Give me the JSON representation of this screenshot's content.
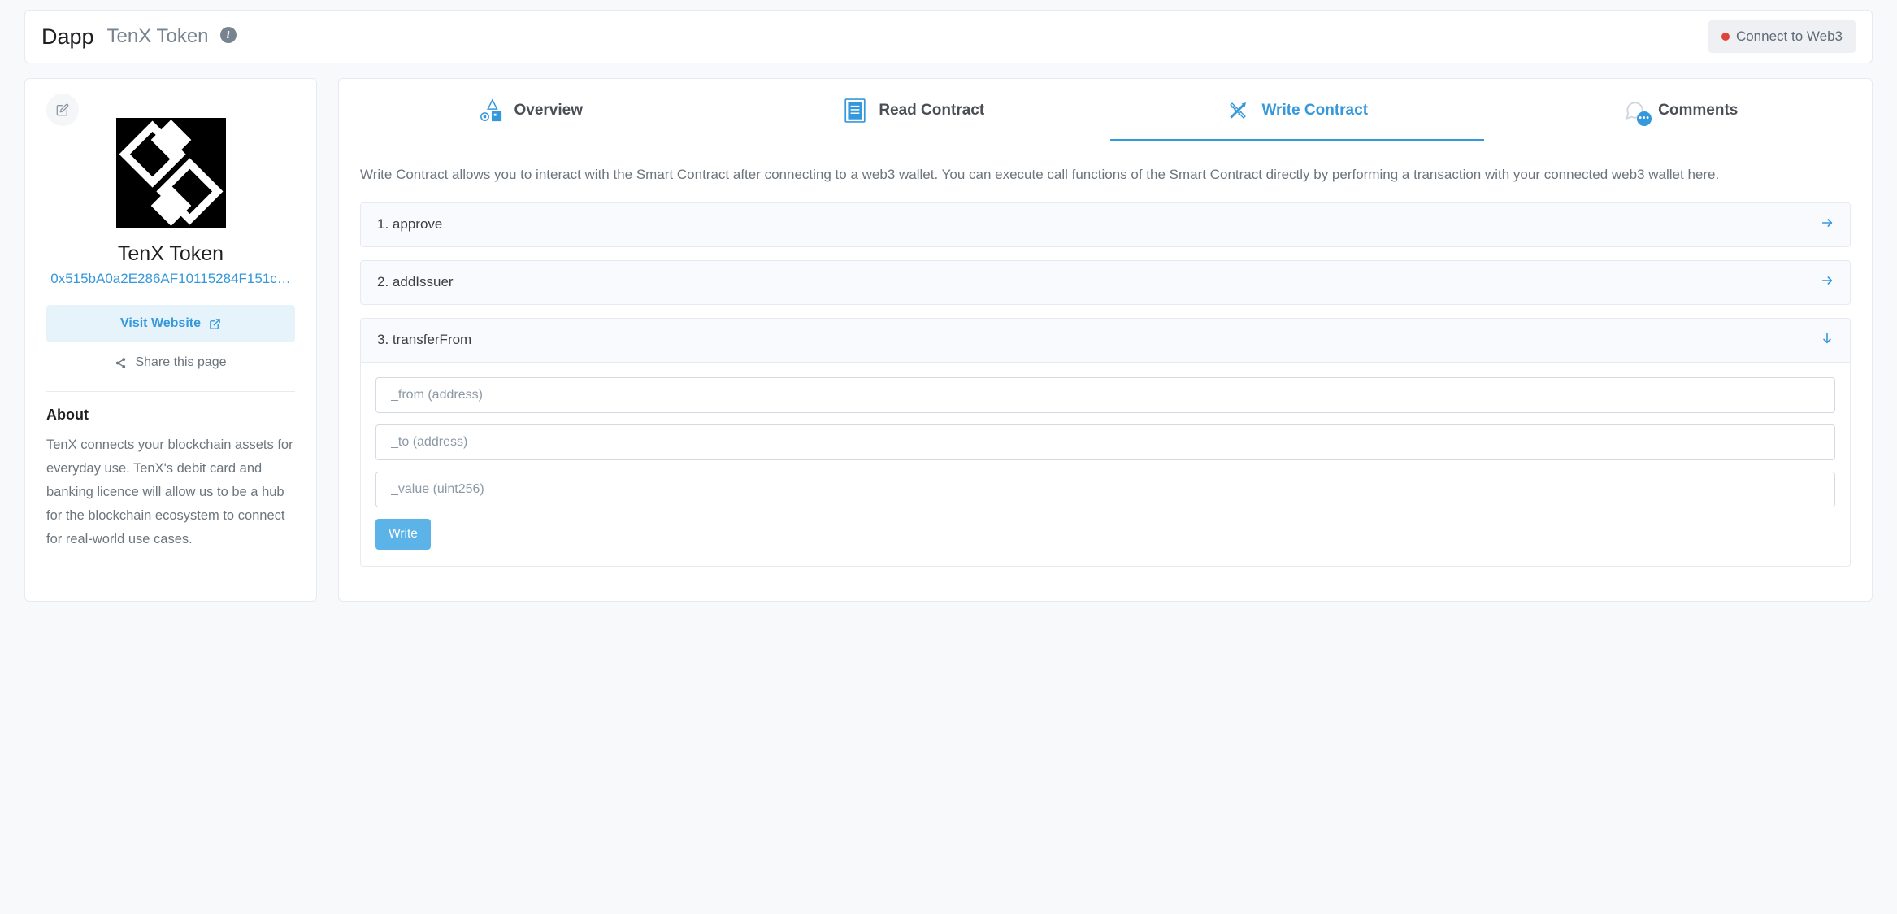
{
  "header": {
    "title": "Dapp",
    "subtitle": "TenX Token",
    "connect_label": "Connect to Web3"
  },
  "sidebar": {
    "token_name": "TenX Token",
    "address": "0x515bA0a2E286AF10115284F151c…",
    "visit_label": "Visit Website",
    "share_label": "Share this page",
    "about_heading": "About",
    "about_text": "TenX connects your blockchain assets for everyday use. TenX's debit card and banking licence will allow us to be a hub for the blockchain ecosystem to connect for real-world use cases."
  },
  "tabs": {
    "overview": "Overview",
    "read": "Read Contract",
    "write": "Write Contract",
    "comments": "Comments"
  },
  "write_contract": {
    "description": "Write Contract allows you to interact with the Smart Contract after connecting to a web3 wallet. You can execute call functions of the Smart Contract directly by performing a transaction with your connected web3 wallet here.",
    "functions": [
      {
        "index": "1.",
        "name": "approve",
        "expanded": false
      },
      {
        "index": "2.",
        "name": "addIssuer",
        "expanded": false
      },
      {
        "index": "3.",
        "name": "transferFrom",
        "expanded": true,
        "inputs": [
          {
            "placeholder": "_from (address)"
          },
          {
            "placeholder": "_to (address)"
          },
          {
            "placeholder": "_value (uint256)"
          }
        ],
        "action_label": "Write"
      }
    ]
  }
}
